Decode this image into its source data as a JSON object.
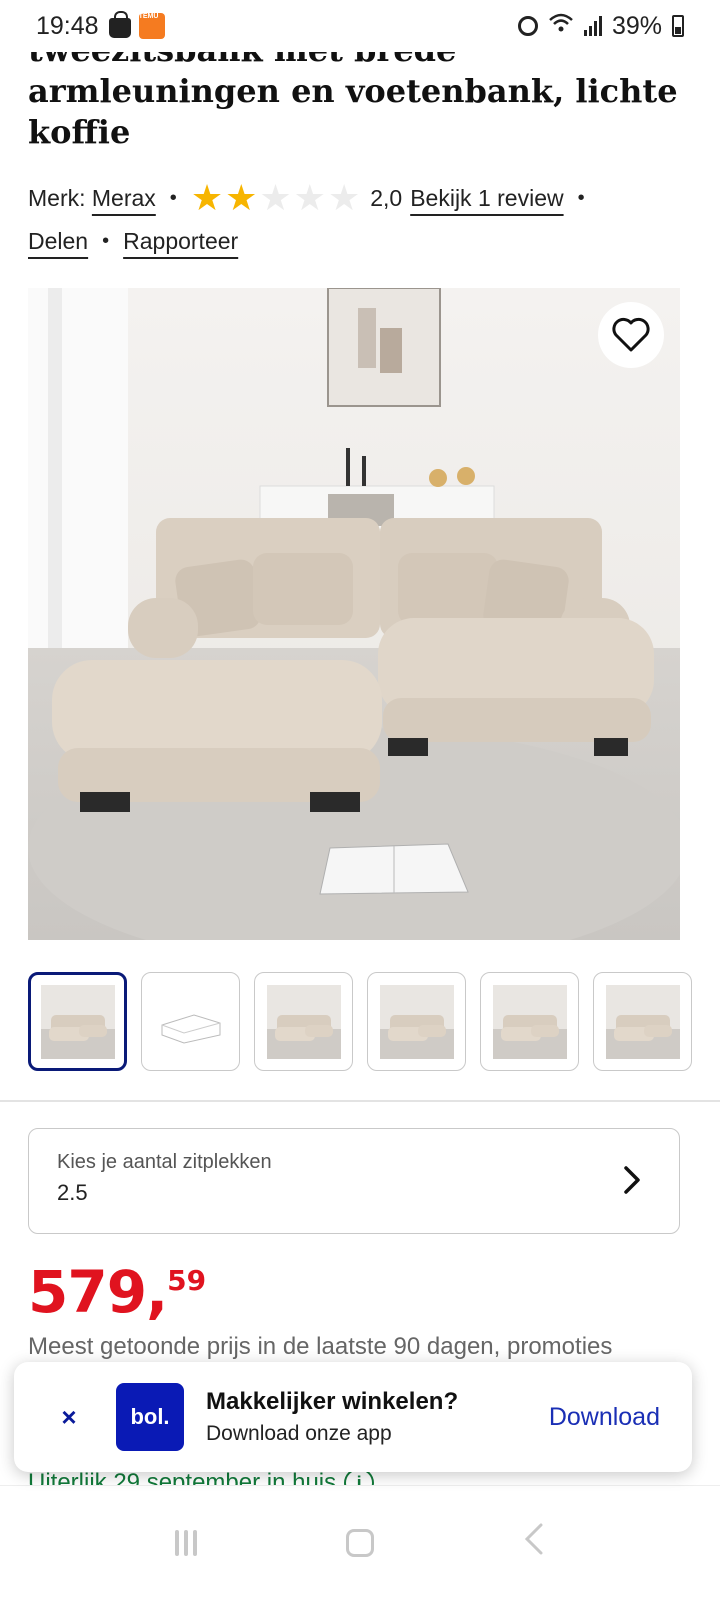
{
  "status_bar": {
    "time": "19:48",
    "temu_label": "TEMU",
    "battery": "39%",
    "icons": [
      "shopping-bag-icon",
      "temu-app-icon",
      "alarm-icon",
      "wifi-icon",
      "signal-icon",
      "battery-icon"
    ]
  },
  "product": {
    "title": "tweezitsbank met brede armleuningen en voetenbank, lichte koffie",
    "brand_label": "Merk:",
    "brand": "Merax",
    "rating_value": "2,0",
    "rating_stars": 2,
    "rating_max": 5,
    "review_link": "Bekijk 1 review",
    "share_link": "Delen",
    "report_link": "Rapporteer"
  },
  "gallery": {
    "thumbnail_count": 6,
    "active_index": 0
  },
  "selector": {
    "label": "Kies je aantal zitplekken",
    "value": "2.5"
  },
  "price": {
    "main": "579,",
    "cents": "59",
    "color": "#e0131f",
    "note": "Meest getoonde prijs in de laatste 90 dagen, promoties"
  },
  "delivery": {
    "text": "Uiterlijk 29 september in huis",
    "color": "#117a3a"
  },
  "app_banner": {
    "close_symbol": "×",
    "logo_text": "bol.",
    "title": "Makkelijker winkelen?",
    "subtitle": "Download onze app",
    "cta": "Download",
    "brand_color": "#0a1ab5"
  }
}
